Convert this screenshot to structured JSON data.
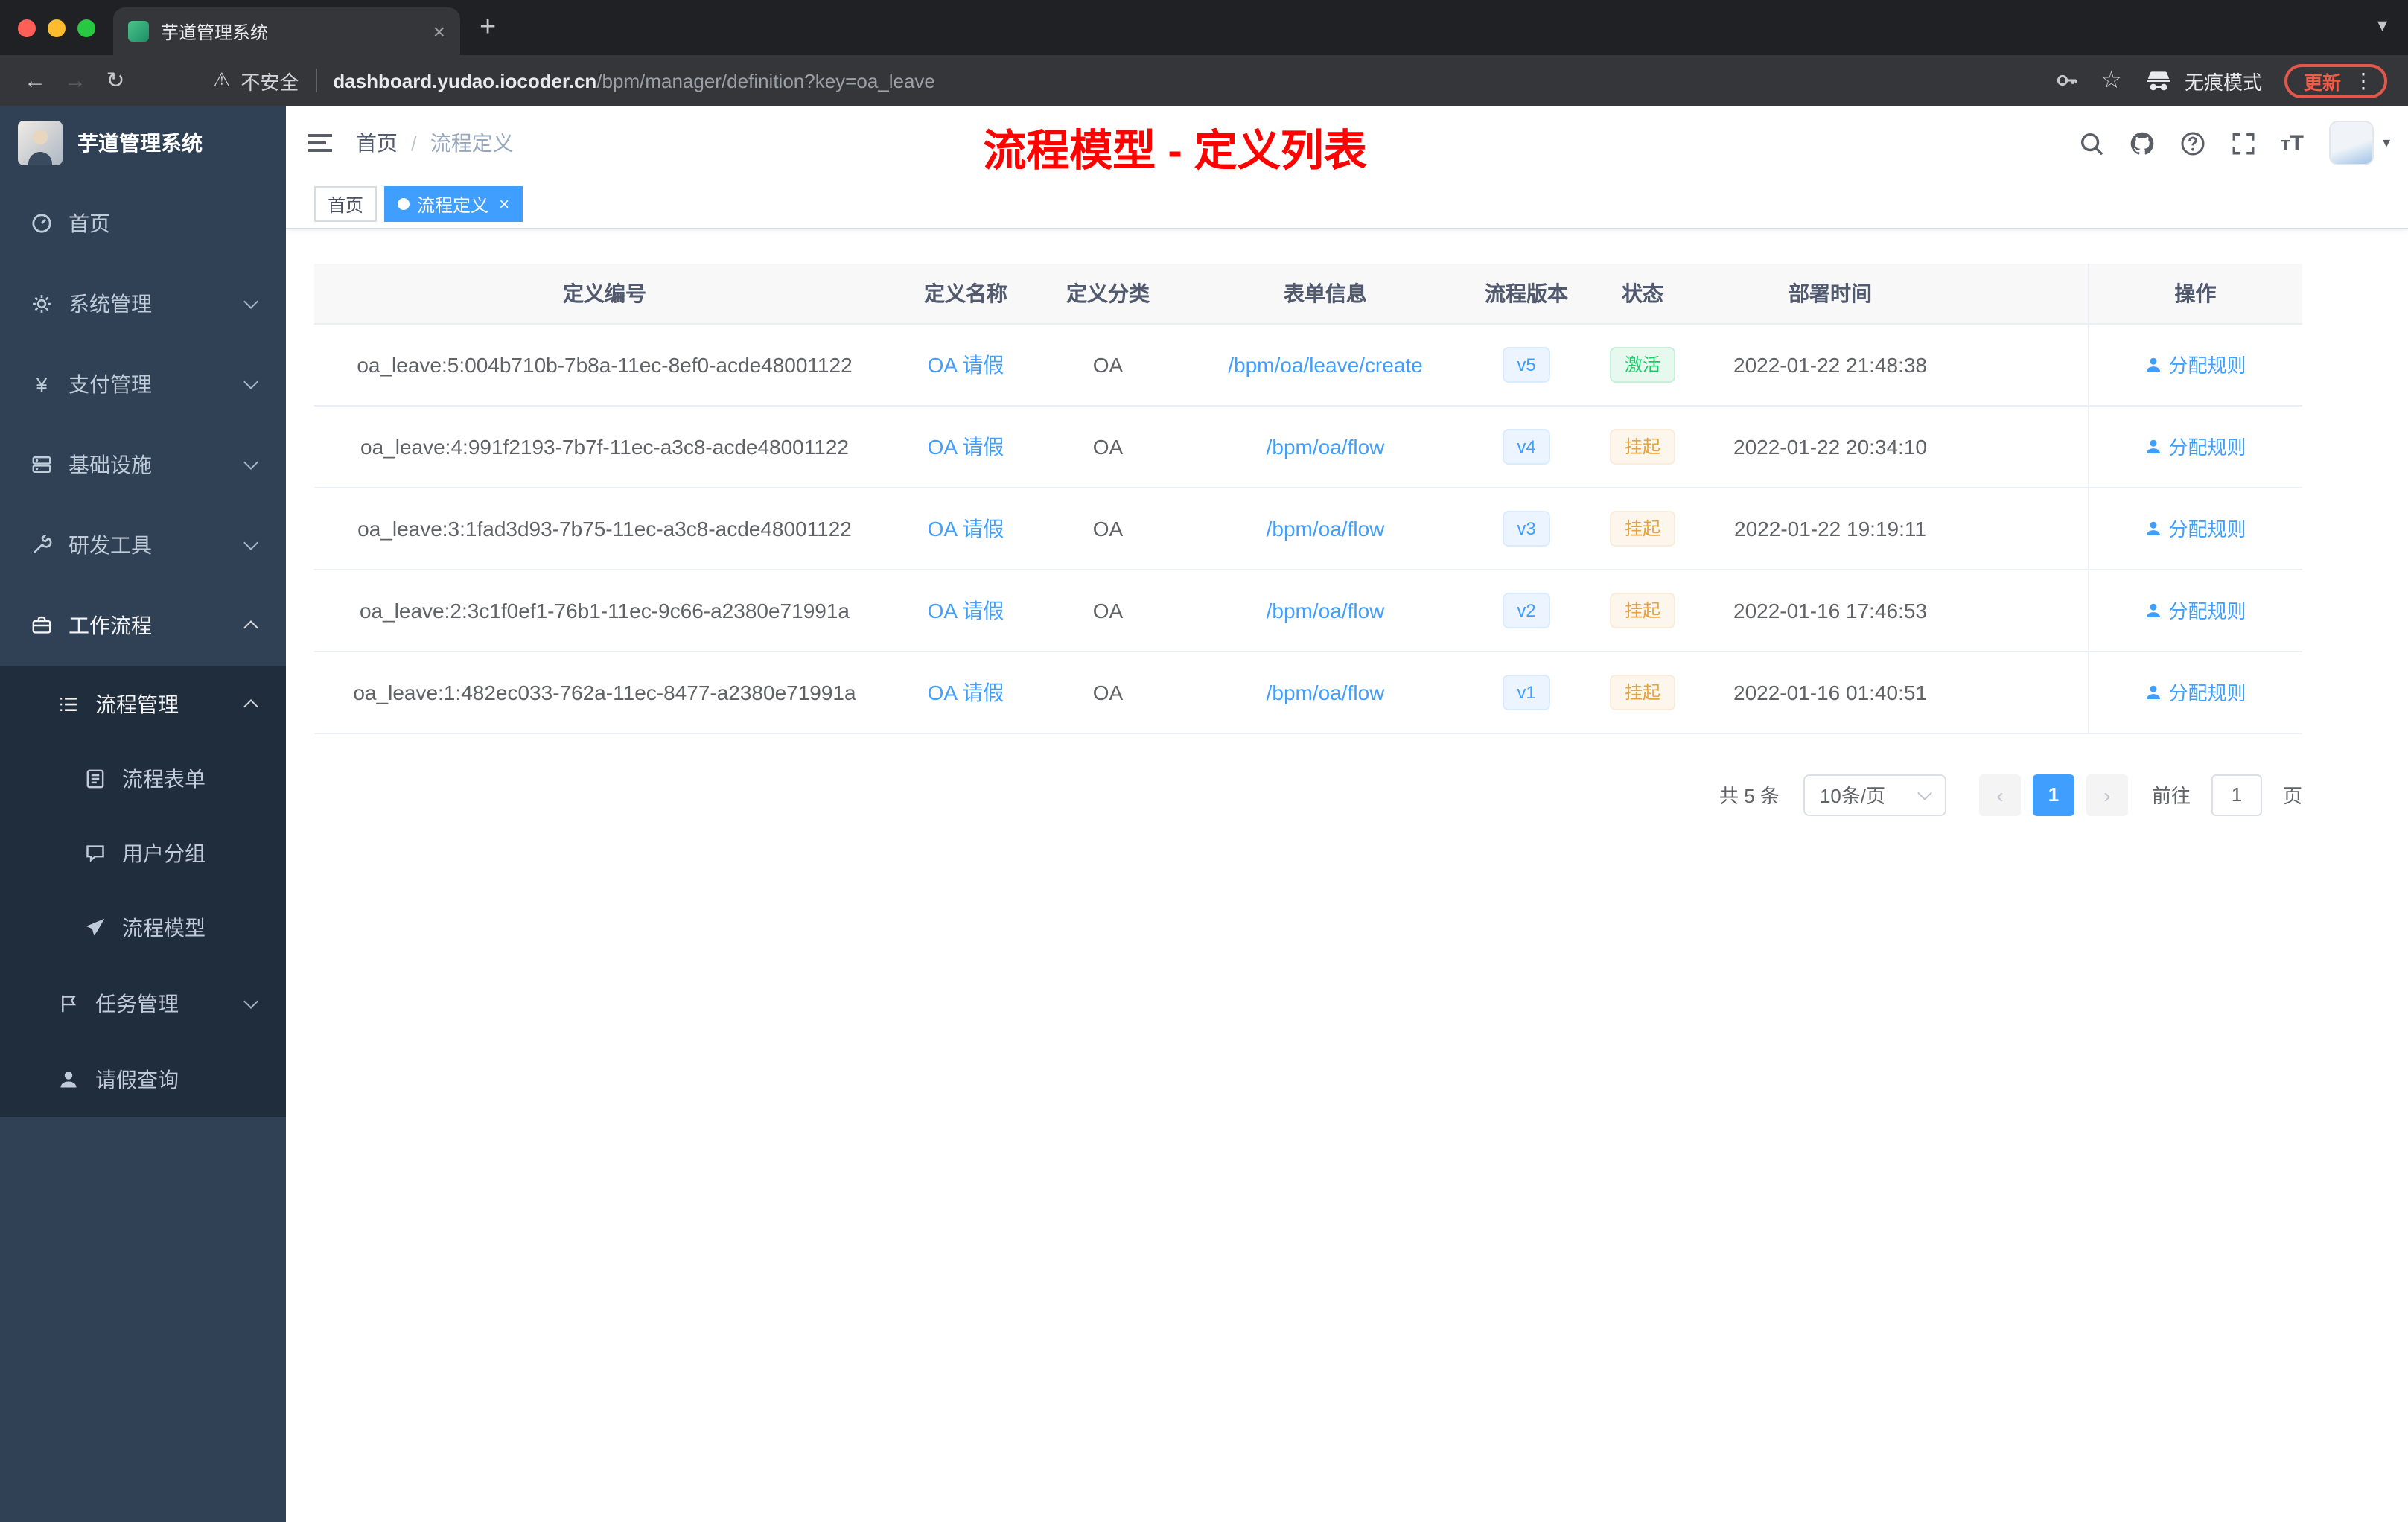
{
  "browser": {
    "tab": {
      "title": "芋道管理系统"
    },
    "address": {
      "security_label": "不安全",
      "url_host": "dashboard.yudao.iocoder.cn",
      "url_path": "/bpm/manager/definition?key=oa_leave",
      "incognito_label": "无痕模式",
      "update_label": "更新"
    }
  },
  "icons": {
    "back": "←",
    "forward": "→",
    "reload": "↻",
    "warning": "⚠",
    "star": "☆",
    "kebab": "⋮",
    "plus": "+",
    "close": "×",
    "chevron_left": "‹",
    "chevron_right": "›",
    "caret_down": "▾",
    "separator": "/"
  },
  "sidebar": {
    "logo_title": "芋道管理系统",
    "items": [
      {
        "name": "sidebar-item-home",
        "label": "首页",
        "icon": "dashboard-icon",
        "depth": 0,
        "chevron": null,
        "bright": false
      },
      {
        "name": "sidebar-item-system-management",
        "label": "系统管理",
        "icon": "gear-icon",
        "depth": 0,
        "chevron": "down",
        "bright": false
      },
      {
        "name": "sidebar-item-payment-management",
        "label": "支付管理",
        "icon": "yen-icon",
        "depth": 0,
        "chevron": "down",
        "bright": false
      },
      {
        "name": "sidebar-item-infrastructure",
        "label": "基础设施",
        "icon": "server-icon",
        "depth": 0,
        "chevron": "down",
        "bright": false
      },
      {
        "name": "sidebar-item-dev-tools",
        "label": "研发工具",
        "icon": "tools-icon",
        "depth": 0,
        "chevron": "down",
        "bright": false
      },
      {
        "name": "sidebar-item-workflow",
        "label": "工作流程",
        "icon": "briefcase-icon",
        "depth": 0,
        "chevron": "up",
        "bright": true
      },
      {
        "name": "sidebar-item-process-management",
        "label": "流程管理",
        "icon": "list-icon",
        "depth": 1,
        "chevron": "up",
        "bright": true
      },
      {
        "name": "sidebar-item-process-form",
        "label": "流程表单",
        "icon": "form-icon",
        "depth": 2,
        "chevron": null,
        "bright": false
      },
      {
        "name": "sidebar-item-user-group",
        "label": "用户分组",
        "icon": "chat-icon",
        "depth": 2,
        "chevron": null,
        "bright": false
      },
      {
        "name": "sidebar-item-process-model",
        "label": "流程模型",
        "icon": "send-icon",
        "depth": 2,
        "chevron": null,
        "bright": false
      },
      {
        "name": "sidebar-item-task-management",
        "label": "任务管理",
        "icon": "flag-icon",
        "depth": 1,
        "chevron": "down",
        "bright": false
      },
      {
        "name": "sidebar-item-leave-query",
        "label": "请假查询",
        "icon": "user-icon",
        "depth": 1,
        "chevron": null,
        "bright": false
      }
    ]
  },
  "header": {
    "breadcrumb": [
      "首页",
      "流程定义"
    ],
    "annotation": "流程模型 - 定义列表"
  },
  "tags": [
    {
      "label": "首页",
      "active": false
    },
    {
      "label": "流程定义",
      "active": true
    }
  ],
  "table": {
    "columns": [
      "定义编号",
      "定义名称",
      "定义分类",
      "表单信息",
      "流程版本",
      "状态",
      "部署时间",
      "操作"
    ],
    "rows": [
      {
        "id": "oa_leave:5:004b710b-7b8a-11ec-8ef0-acde48001122",
        "name": "OA 请假",
        "category": "OA",
        "form": "/bpm/oa/leave/create",
        "version": "v5",
        "status": "激活",
        "status_type": "success",
        "time": "2022-01-22 21:48:38",
        "action": "分配规则"
      },
      {
        "id": "oa_leave:4:991f2193-7b7f-11ec-a3c8-acde48001122",
        "name": "OA 请假",
        "category": "OA",
        "form": "/bpm/oa/flow",
        "version": "v4",
        "status": "挂起",
        "status_type": "warning",
        "time": "2022-01-22 20:34:10",
        "action": "分配规则"
      },
      {
        "id": "oa_leave:3:1fad3d93-7b75-11ec-a3c8-acde48001122",
        "name": "OA 请假",
        "category": "OA",
        "form": "/bpm/oa/flow",
        "version": "v3",
        "status": "挂起",
        "status_type": "warning",
        "time": "2022-01-22 19:19:11",
        "action": "分配规则"
      },
      {
        "id": "oa_leave:2:3c1f0ef1-76b1-11ec-9c66-a2380e71991a",
        "name": "OA 请假",
        "category": "OA",
        "form": "/bpm/oa/flow",
        "version": "v2",
        "status": "挂起",
        "status_type": "warning",
        "time": "2022-01-16 17:46:53",
        "action": "分配规则"
      },
      {
        "id": "oa_leave:1:482ec033-762a-11ec-8477-a2380e71991a",
        "name": "OA 请假",
        "category": "OA",
        "form": "/bpm/oa/flow",
        "version": "v1",
        "status": "挂起",
        "status_type": "warning",
        "time": "2022-01-16 01:40:51",
        "action": "分配规则"
      }
    ]
  },
  "pagination": {
    "total": "共 5 条",
    "page_size": "10条/页",
    "current_page": "1",
    "goto_label": "前往",
    "goto_value": "1",
    "page_unit": "页"
  },
  "colors": {
    "accent": "#409eff",
    "success": "#13ce66",
    "warning": "#e6a23c",
    "annotation": "#fe0100",
    "sidebar_bg": "#304156",
    "submenu_bg": "#1f2d3d"
  }
}
